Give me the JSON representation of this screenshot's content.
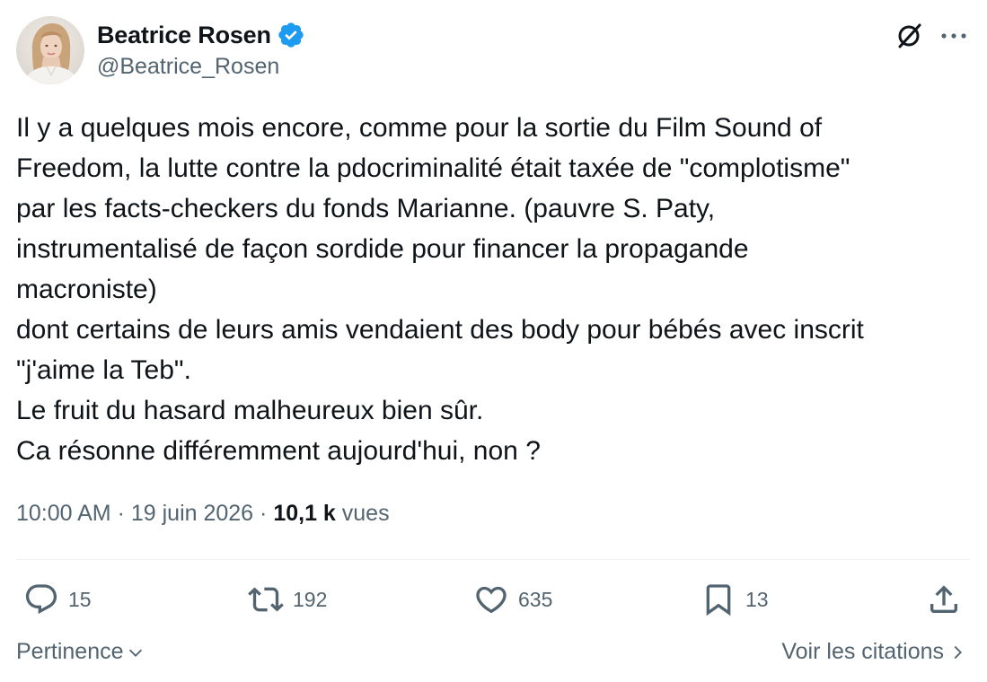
{
  "author": {
    "display_name": "Beatrice Rosen",
    "handle": "@Beatrice_Rosen",
    "verified_color": "#1d9bf0"
  },
  "header": {
    "grok_icon": "grok-icon",
    "more_icon": "more-icon"
  },
  "tweet": {
    "lines": [
      "Il y a quelques mois encore, comme pour la sortie du Film Sound of",
      "Freedom, la lutte contre la pdocriminalité était taxée de \"complotisme\"",
      "par les facts-checkers du fonds Marianne. (pauvre S. Paty,",
      "instrumentalisé de façon sordide pour financer la propagande",
      "macroniste)",
      "dont certains de leurs amis vendaient des body pour bébés avec inscrit",
      "\"j'aime la Teb\".",
      "Le fruit du hasard malheureux bien sûr.",
      "Ca résonne différemment aujourd'hui, non ?"
    ]
  },
  "meta": {
    "time": "10:00 AM",
    "separator": " · ",
    "date": "19 juin 2026",
    "separator2": " · ",
    "views_count": "10,1 k",
    "views_label": " vues"
  },
  "actions": {
    "replies": "15",
    "retweets": "192",
    "likes": "635",
    "bookmarks": "13"
  },
  "footer": {
    "sort_label": "Pertinence",
    "quotes_label": "Voir les citations"
  },
  "colors": {
    "text": "#0f1419",
    "secondary": "#536471",
    "divider": "#eff3f4",
    "accent": "#1d9bf0"
  }
}
